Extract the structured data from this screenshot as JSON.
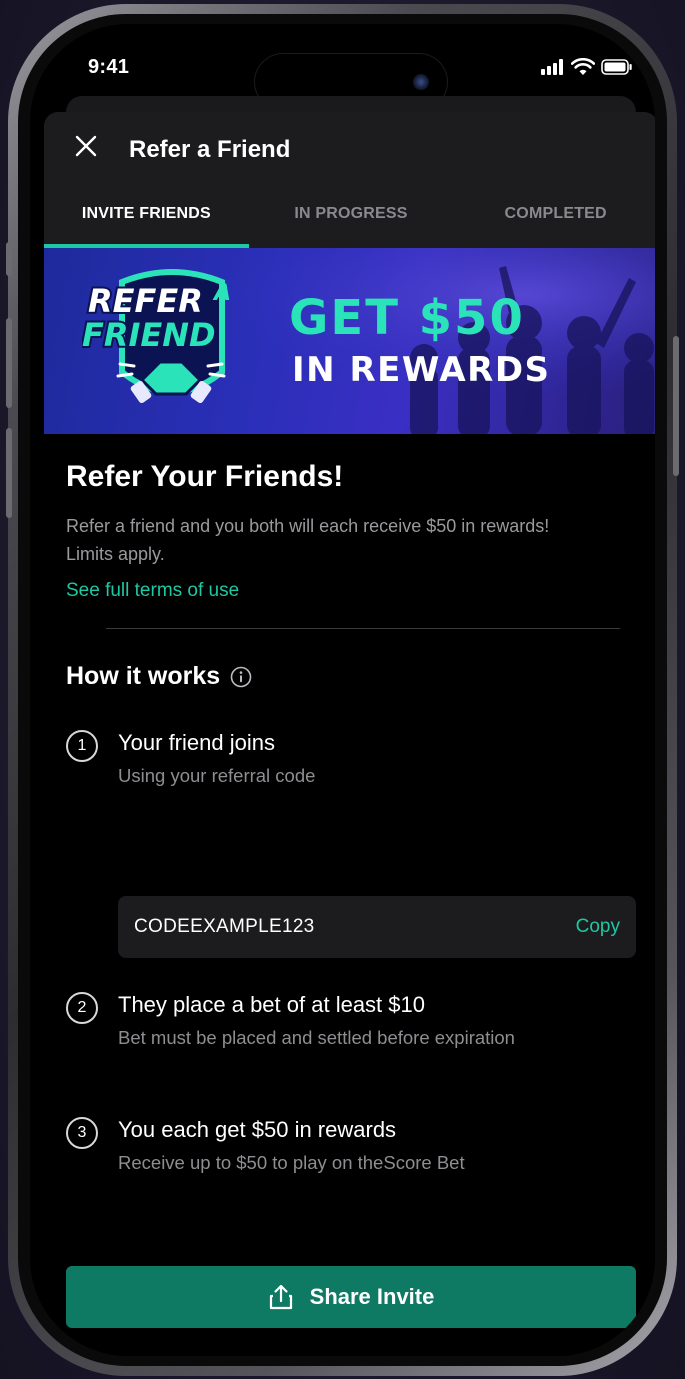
{
  "status_bar": {
    "time": "9:41"
  },
  "header": {
    "title": "Refer a Friend"
  },
  "tabs": [
    {
      "label": "INVITE FRIENDS",
      "active": true
    },
    {
      "label": "IN PROGRESS",
      "active": false
    },
    {
      "label": "COMPLETED",
      "active": false
    }
  ],
  "banner": {
    "logo_line1": "REFER",
    "logo_a": "A",
    "logo_line2": "FRIEND",
    "headline": "GET $50",
    "subheadline": "IN REWARDS"
  },
  "content": {
    "heading": "Refer Your Friends!",
    "description": "Refer a friend and you both will each receive $50 in rewards! Limits apply.",
    "terms_link": "See full terms of use",
    "how_it_works": "How it works"
  },
  "steps": [
    {
      "number": "1",
      "title": "Your friend joins",
      "subtitle": "Using your referral code"
    },
    {
      "number": "2",
      "title": "They place a bet of at least $10",
      "subtitle": "Bet must be placed and settled before expiration"
    },
    {
      "number": "3",
      "title": "You each get $50 in rewards",
      "subtitle": "Receive up to $50 to play on theScore Bet"
    }
  ],
  "referral": {
    "code": "CODEEXAMPLE123",
    "copy_label": "Copy"
  },
  "share_button": {
    "label": "Share Invite"
  },
  "colors": {
    "accent": "#1fc7a2",
    "button": "#0f7a63",
    "background": "#000000",
    "surface": "#1c1c1e"
  }
}
